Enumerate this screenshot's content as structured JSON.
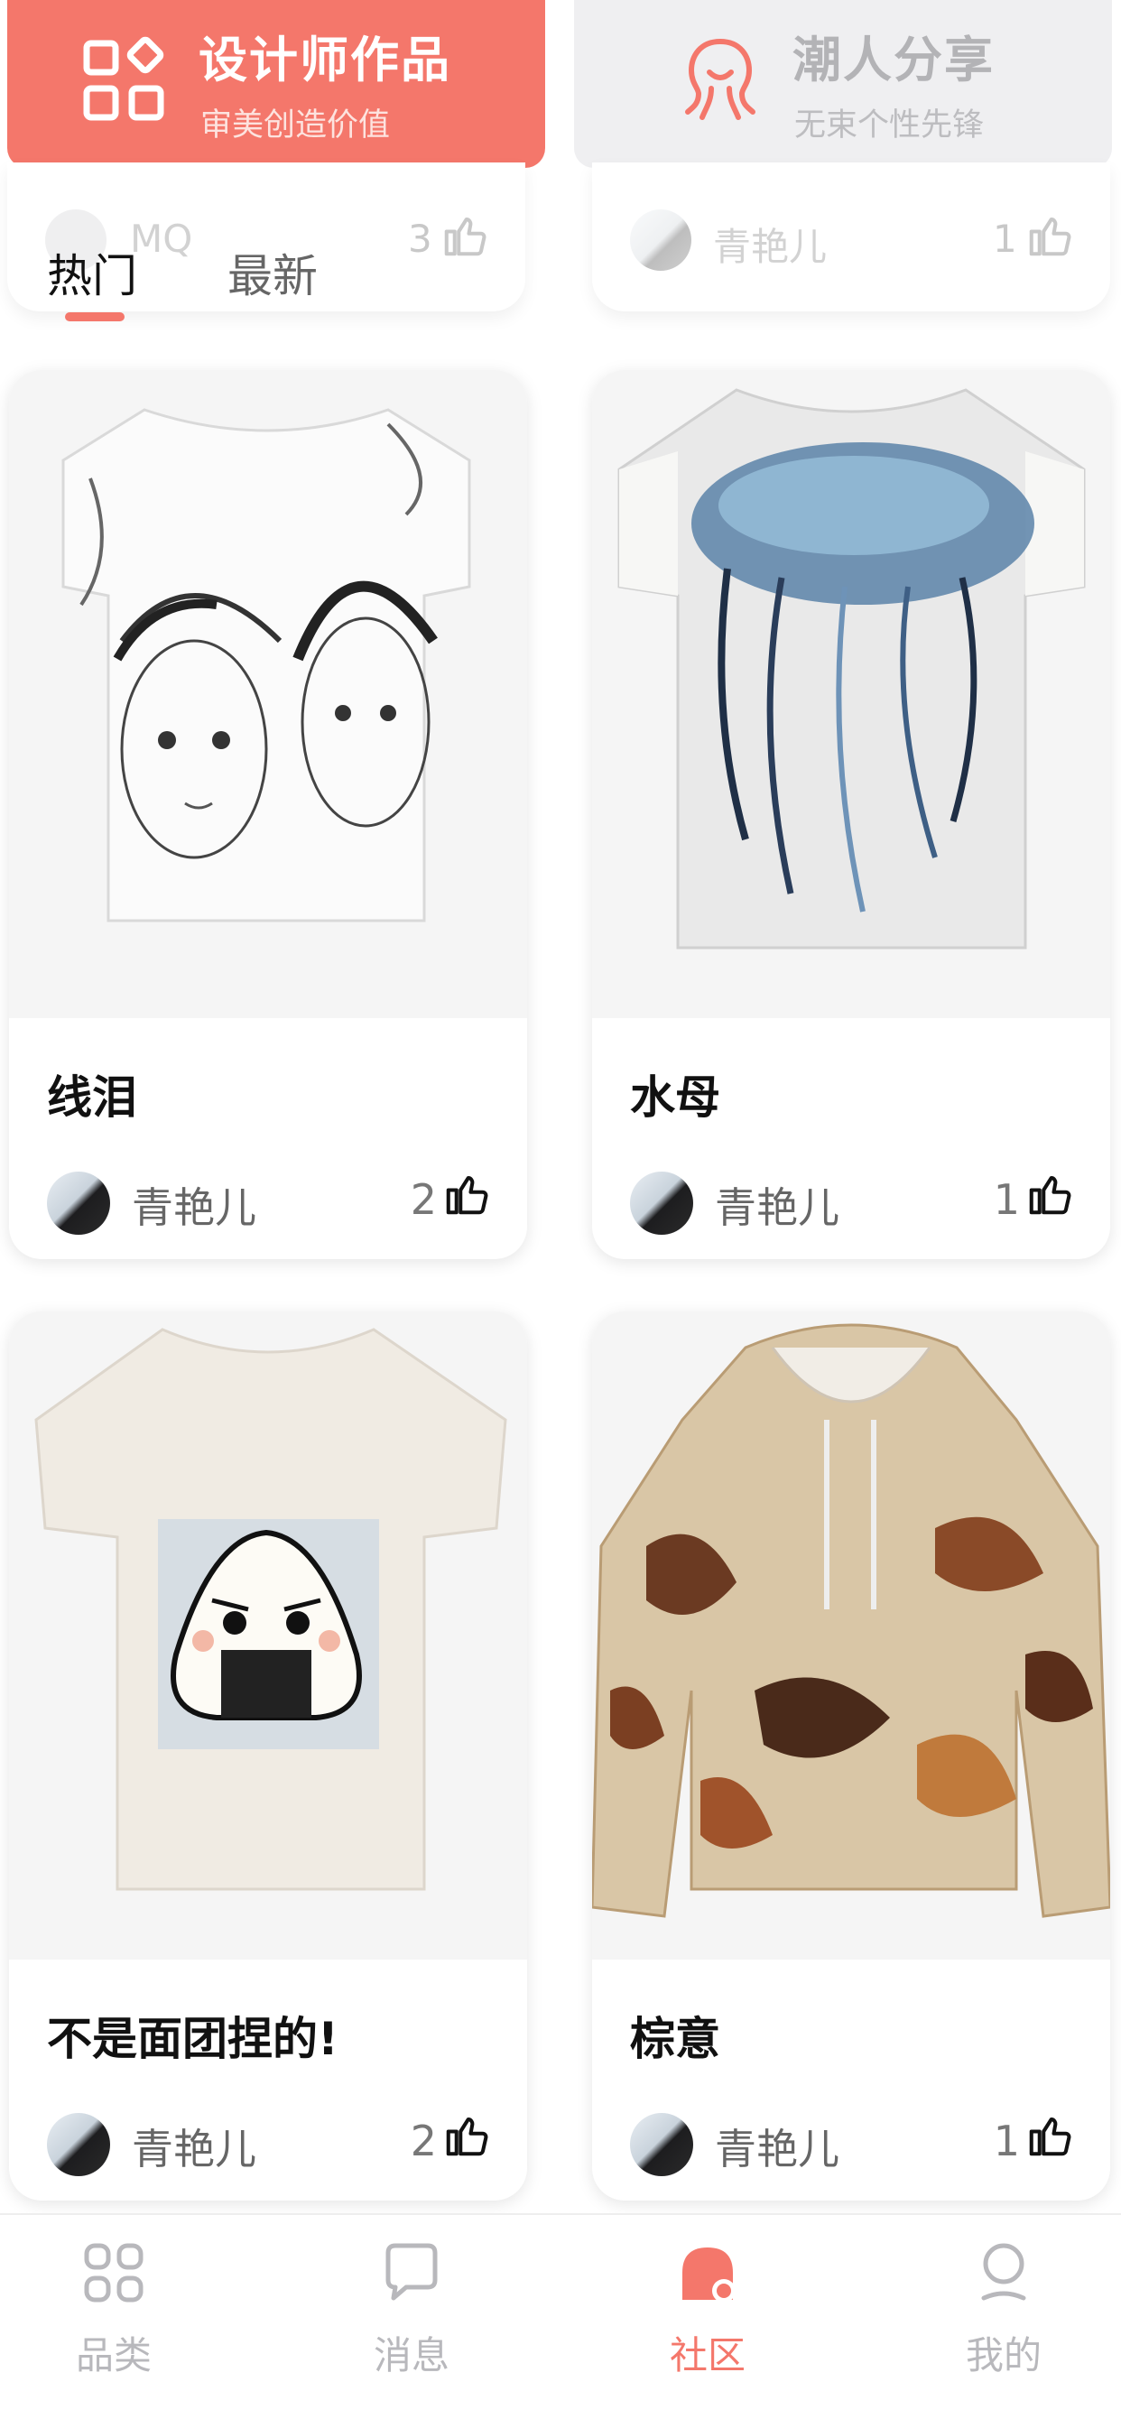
{
  "categories": [
    {
      "title": "设计师作品",
      "subtitle": "审美创造价值",
      "icon": "grid-icon",
      "color": "#f4776b"
    },
    {
      "title": "潮人分享",
      "subtitle": "无束个性先锋",
      "icon": "octopus-icon",
      "color": "#efeff1"
    }
  ],
  "peek": [
    {
      "author": "MQ",
      "likes": "3"
    },
    {
      "author": "青艳儿",
      "likes": "1"
    }
  ],
  "tabs": [
    {
      "label": "热门",
      "active": true
    },
    {
      "label": "最新",
      "active": false
    }
  ],
  "products": [
    {
      "title": "线泪",
      "author": "青艳儿",
      "likes": "2",
      "image": "tshirt-sketch-faces"
    },
    {
      "title": "水母",
      "author": "青艳儿",
      "likes": "1",
      "image": "tshirt-jellyfish"
    },
    {
      "title": "不是面团捏的!",
      "author": "青艳儿",
      "likes": "2",
      "image": "tshirt-onigiri"
    },
    {
      "title": "棕意",
      "author": "青艳儿",
      "likes": "1",
      "image": "hoodie-brown-pattern"
    }
  ],
  "nav": [
    {
      "label": "品类",
      "icon": "category-icon",
      "active": false
    },
    {
      "label": "消息",
      "icon": "message-icon",
      "active": false
    },
    {
      "label": "社区",
      "icon": "community-icon",
      "active": true
    },
    {
      "label": "我的",
      "icon": "profile-icon",
      "active": false
    }
  ],
  "colors": {
    "accent": "#f4776b",
    "inactive": "#b8b8bc"
  }
}
